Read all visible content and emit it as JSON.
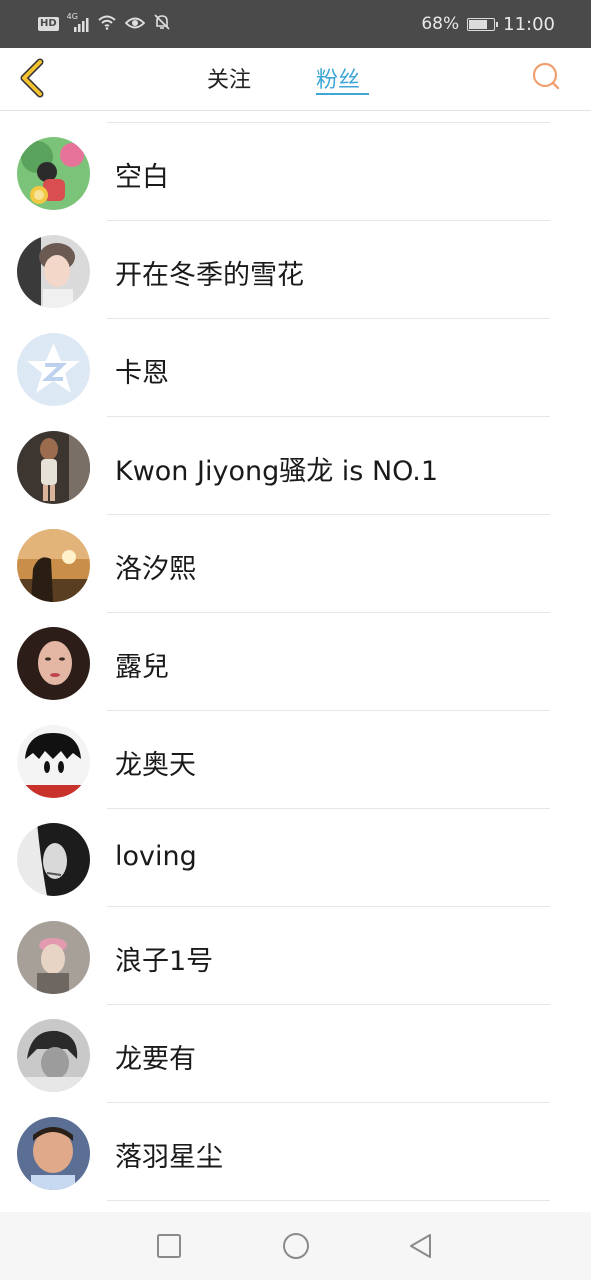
{
  "status_bar": {
    "network_badge": "HD",
    "signal_label": "4G",
    "battery_percent": "68%",
    "battery_level": 0.68,
    "time": "11:00"
  },
  "header": {
    "back_icon": "chevron-left-icon",
    "tabs": [
      {
        "label": "关注",
        "active": false
      },
      {
        "label": "粉丝",
        "active": true
      }
    ],
    "search_icon": "search-icon",
    "accent_color": "#3fa7d8",
    "back_color": "#f2c230"
  },
  "fans": [
    {
      "name": "空白"
    },
    {
      "name": "开在冬季的雪花"
    },
    {
      "name": "卡恩"
    },
    {
      "name": "Kwon Jiyong骚龙 is NO.1"
    },
    {
      "name": "洛汐熙"
    },
    {
      "name": "露兒"
    },
    {
      "name": "龙奥天"
    },
    {
      "name": "loving"
    },
    {
      "name": "浪子1号"
    },
    {
      "name": "龙要有"
    },
    {
      "name": "落羽星尘"
    }
  ],
  "nav_bar": {
    "recent_icon": "square-icon",
    "home_icon": "circle-icon",
    "back_icon": "triangle-back-icon"
  }
}
